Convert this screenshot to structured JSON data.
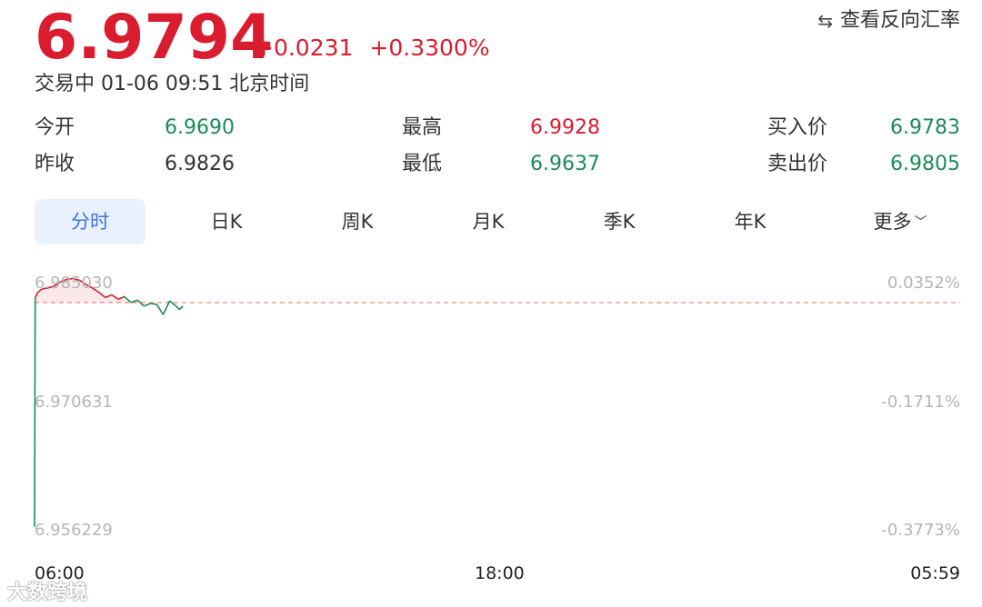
{
  "header": {
    "price": "6.9794",
    "change_abs": "+0.0231",
    "change_pct": "+0.3300%",
    "reverse_label": "查看反向汇率",
    "status": "交易中 01-06 09:51 北京时间"
  },
  "quote": {
    "open_label": "今开",
    "open_value": "6.9690",
    "prev_close_label": "昨收",
    "prev_close_value": "6.9826",
    "high_label": "最高",
    "high_value": "6.9928",
    "low_label": "最低",
    "low_value": "6.9637",
    "bid_label": "买入价",
    "bid_value": "6.9783",
    "ask_label": "卖出价",
    "ask_value": "6.9805"
  },
  "tabs": [
    {
      "label": "分时",
      "active": true
    },
    {
      "label": "日K",
      "active": false
    },
    {
      "label": "周K",
      "active": false
    },
    {
      "label": "月K",
      "active": false
    },
    {
      "label": "季K",
      "active": false
    },
    {
      "label": "年K",
      "active": false
    },
    {
      "label": "更多",
      "active": false
    }
  ],
  "colors": {
    "up": "#d91c2e",
    "down": "#1a8a5a",
    "accent": "#3b73e0",
    "baseline": "#f08a8a"
  },
  "chart_data": {
    "type": "line",
    "y_left_labels": [
      "6.985030",
      "6.970631",
      "6.956229"
    ],
    "y_right_labels": [
      "0.0352%",
      "-0.1711%",
      "-0.3773%"
    ],
    "ylim": [
      6.956229,
      6.98503
    ],
    "baseline": 6.9826,
    "x_labels": [
      "06:00",
      "18:00",
      "05:59"
    ],
    "series": [
      {
        "x": [
          "06:00",
          "06:01",
          "06:05",
          "06:12",
          "06:20",
          "06:30",
          "06:40",
          "06:50",
          "07:00",
          "07:10",
          "07:20",
          "07:30",
          "07:40",
          "07:50",
          "08:00",
          "08:10",
          "08:20",
          "08:30",
          "08:40",
          "08:50",
          "09:00",
          "09:10",
          "09:20",
          "09:30",
          "09:40",
          "09:45",
          "09:48",
          "09:51"
        ],
        "values": [
          6.9566,
          6.9832,
          6.9838,
          6.9842,
          6.9843,
          6.9845,
          6.985,
          6.9853,
          6.9854,
          6.9852,
          6.9847,
          6.9843,
          6.9838,
          6.9832,
          6.9835,
          6.983,
          6.9833,
          6.9826,
          6.9829,
          6.9822,
          6.9825,
          6.9824,
          6.9812,
          6.9828,
          6.9822,
          6.9818,
          6.982,
          6.9822
        ]
      }
    ]
  },
  "watermark": "大数跨境"
}
